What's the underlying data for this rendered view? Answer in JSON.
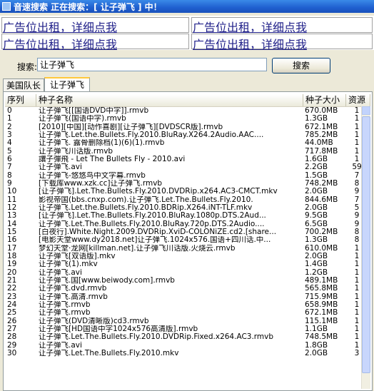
{
  "window": {
    "title": "音速搜索  正在搜索：[ 让子弹飞 ] 中！"
  },
  "ads": [
    "广告位出租，详细点我",
    "广告位出租，详细点我",
    "广告位出租，详细点我",
    "广告位出租，详细点我"
  ],
  "search": {
    "label": "搜索:",
    "value": "让子弹飞",
    "button": "搜索"
  },
  "tabs": [
    {
      "label": "美国队长",
      "active": false
    },
    {
      "label": "让子弹飞",
      "active": true
    }
  ],
  "table": {
    "columns": [
      "序列",
      "种子名称",
      "种子大小",
      "资源"
    ],
    "rows": [
      [
        "0",
        "让子弹飞[[国语DVD中字]].rmvb",
        "670.0MB",
        "1"
      ],
      [
        "1",
        "让子弹飞(国语中字).rmvb",
        "1.3GB",
        "1"
      ],
      [
        "2",
        "[2010][中国][动作喜剧][让子弹飞][DVDSCR版].rmvb",
        "672.1MB",
        "1"
      ],
      [
        "3",
        "让子弹飞.Let.the.Bullets.Fly.2010.BluRay.X264.2Audio.AAC....",
        "785.2MB",
        "1"
      ],
      [
        "4",
        "让子弹飞. 露骨删除档(1)(6)(1).rmvb",
        "44.0MB",
        "1"
      ],
      [
        "5",
        "让子弹飞川话版.rmvb",
        "717.8MB",
        "1"
      ],
      [
        "6",
        "讓子彈飛 - Let The Bullets Fly - 2010.avi",
        "1.6GB",
        "1"
      ],
      [
        "7",
        "让子弹飞.avi",
        "2.2GB",
        "59"
      ],
      [
        "8",
        "让子弹飞-悠悠鸟中文字幕.rmvb",
        "1.5GB",
        "7"
      ],
      [
        "9",
        "[下载库www.xzk.cc]让子弹飞.rmvb",
        "748.2MB",
        "8"
      ],
      [
        "10",
        "[让子弹飞].Let.The.Bullets.Fly.2010.DVDRip.x264.AC3-CMCT.mkv",
        "2.0GB",
        "9"
      ],
      [
        "11",
        "影视帝国(bbs.cnxp.com).让子弹飞.Let.The.Bullets.Fly.2010.",
        "844.6MB",
        "7"
      ],
      [
        "12",
        "让子弹飞.Let.the.Bullets.Fly.2010.BDRip.X264.iNT-TLF.mkv",
        "2.0GB",
        "5"
      ],
      [
        "13",
        "[让子弹飞].Let.The.Bullets.Fly.2010.BluRay.1080p.DTS.2Aud...",
        "9.5GB",
        "9"
      ],
      [
        "14",
        "让子弹飞.Let.The.Bullets.Fly.2010.BluRay.720p.DTS.2Audio....",
        "6.5GB",
        "9"
      ],
      [
        "15",
        "[白夜行].White.Night.2009.DVDRip.XviD-COLONiZE.cd2.[share...",
        "700.2MB",
        "8"
      ],
      [
        "16",
        "[电影天堂www.dy2018.net]让子弹飞.1024x576.国语+四川话.中...",
        "1.3GB",
        "8"
      ],
      [
        "17",
        "梦幻天堂·龙网[killman.net].让子弹飞川话版.火烧云.rmvb",
        "610.0MB",
        "1"
      ],
      [
        "18",
        "让子弹飞[双语版].mkv",
        "2.0GB",
        "1"
      ],
      [
        "19",
        "让子弹飞(1).mkv",
        "1.4GB",
        "1"
      ],
      [
        "20",
        "让子弹飞.avi",
        "1.2GB",
        "1"
      ],
      [
        "21",
        "让子弹飞.国[www.beiwody.com].rmvb",
        "489.1MB",
        "1"
      ],
      [
        "22",
        "让子弹飞.dvd.rmvb",
        "565.8MB",
        "1"
      ],
      [
        "23",
        "让子弹飞.高清.rmvb",
        "715.9MB",
        "1"
      ],
      [
        "24",
        "让子弹飞.rmvb",
        "658.9MB",
        "1"
      ],
      [
        "25",
        "让子弹飞.rmvb",
        "672.1MB",
        "1"
      ],
      [
        "26",
        "让子弹飞(DVD清晰版)cd3.rmvb",
        "115.1MB",
        "1"
      ],
      [
        "27",
        "让子弹飞[HD国语中字1024x576高清版].rmvb",
        "1.1GB",
        "1"
      ],
      [
        "28",
        "让子弹飞.Let.The.Bullets.Fly.2010.DVDRip.Fixed.x264.AC3.rmvb",
        "748.5MB",
        "1"
      ],
      [
        "29",
        "让子弹飞.avi",
        "1.8GB",
        "1"
      ],
      [
        "30",
        "让子弹飞.Let.The.Bullets.Fly.2010.mkv",
        "2.0GB",
        "3"
      ]
    ]
  }
}
